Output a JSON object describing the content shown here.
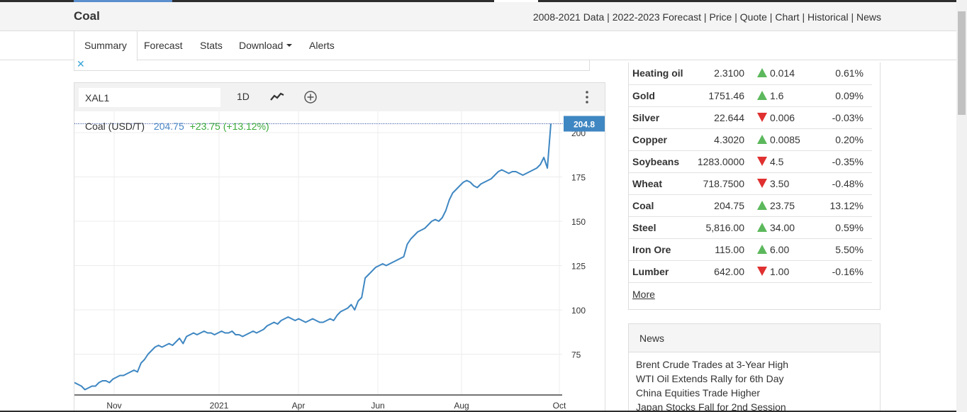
{
  "header": {
    "title": "Coal",
    "links": [
      "2008-2021 Data",
      "2022-2023 Forecast",
      "Price",
      "Quote",
      "Chart",
      "Historical",
      "News"
    ]
  },
  "tabs": [
    "Summary",
    "Forecast",
    "Stats",
    "Download",
    "Alerts"
  ],
  "ad": {
    "close": "✕"
  },
  "chart_toolbar": {
    "symbol": "XAL1",
    "interval": "1D"
  },
  "quote": {
    "name": "Coal (USD/T)",
    "price": "204.75",
    "change": "+23.75 (+13.12%)"
  },
  "colors": {
    "line": "#3f87c2",
    "up": "#5cb85c",
    "down": "#e03030",
    "accent": "#4a86c5"
  },
  "chart_data": {
    "type": "line",
    "x_tick_labels": [
      "Nov",
      "2021",
      "Apr",
      "Jun",
      "Aug",
      "Oct"
    ],
    "y_ticks": [
      75,
      100,
      125,
      150,
      175,
      200
    ],
    "ylim": [
      52,
      212
    ],
    "last_value_label": "204.8",
    "series": [
      {
        "values": [
          59,
          58,
          57,
          55,
          56,
          57,
          57,
          59,
          60,
          60,
          59,
          61,
          62,
          63,
          63,
          64,
          65,
          66,
          65,
          70,
          72,
          75,
          77,
          79,
          80,
          79,
          80,
          81,
          80,
          82,
          84,
          81,
          85,
          86,
          87,
          86,
          87,
          88,
          87,
          87,
          86,
          87,
          88,
          87,
          87,
          88,
          86,
          86,
          85,
          86,
          87,
          88,
          87,
          88,
          89,
          91,
          92,
          93,
          92,
          94,
          95,
          96,
          95,
          94,
          95,
          94,
          93,
          94,
          95,
          94,
          93,
          93,
          94,
          95,
          94,
          97,
          99,
          100,
          101,
          103,
          100,
          105,
          107,
          118,
          120,
          122,
          124,
          125,
          126,
          125,
          126,
          127,
          128,
          129,
          130,
          137,
          140,
          142,
          144,
          145,
          146,
          148,
          150,
          151,
          150,
          152,
          156,
          162,
          166,
          168,
          170,
          172,
          173,
          172,
          170,
          169,
          171,
          172,
          173,
          174,
          176,
          178,
          179,
          178,
          177,
          178,
          178,
          177,
          176,
          177,
          178,
          179,
          180,
          182,
          186,
          180,
          205
        ]
      }
    ]
  },
  "markets": [
    {
      "name": "Heating oil",
      "price": "2.3100",
      "dir": "up",
      "change": "0.014",
      "pct": "0.61%"
    },
    {
      "name": "Gold",
      "price": "1751.46",
      "dir": "up",
      "change": "1.6",
      "pct": "0.09%"
    },
    {
      "name": "Silver",
      "price": "22.644",
      "dir": "down",
      "change": "0.006",
      "pct": "-0.03%"
    },
    {
      "name": "Copper",
      "price": "4.3020",
      "dir": "up",
      "change": "0.0085",
      "pct": "0.20%"
    },
    {
      "name": "Soybeans",
      "price": "1283.0000",
      "dir": "down",
      "change": "4.5",
      "pct": "-0.35%"
    },
    {
      "name": "Wheat",
      "price": "718.7500",
      "dir": "down",
      "change": "3.50",
      "pct": "-0.48%"
    },
    {
      "name": "Coal",
      "price": "204.75",
      "dir": "up",
      "change": "23.75",
      "pct": "13.12%"
    },
    {
      "name": "Steel",
      "price": "5,816.00",
      "dir": "up",
      "change": "34.00",
      "pct": "0.59%"
    },
    {
      "name": "Iron Ore",
      "price": "115.00",
      "dir": "up",
      "change": "6.00",
      "pct": "5.50%"
    },
    {
      "name": "Lumber",
      "price": "642.00",
      "dir": "down",
      "change": "1.00",
      "pct": "-0.16%"
    }
  ],
  "more_label": "More",
  "news": {
    "title": "News",
    "items": [
      "Brent Crude Trades at 3-Year High",
      "WTI Oil Extends Rally for 6th Day",
      "China Equities Trade Higher",
      "Japan Stocks Fall for 2nd Session"
    ]
  }
}
